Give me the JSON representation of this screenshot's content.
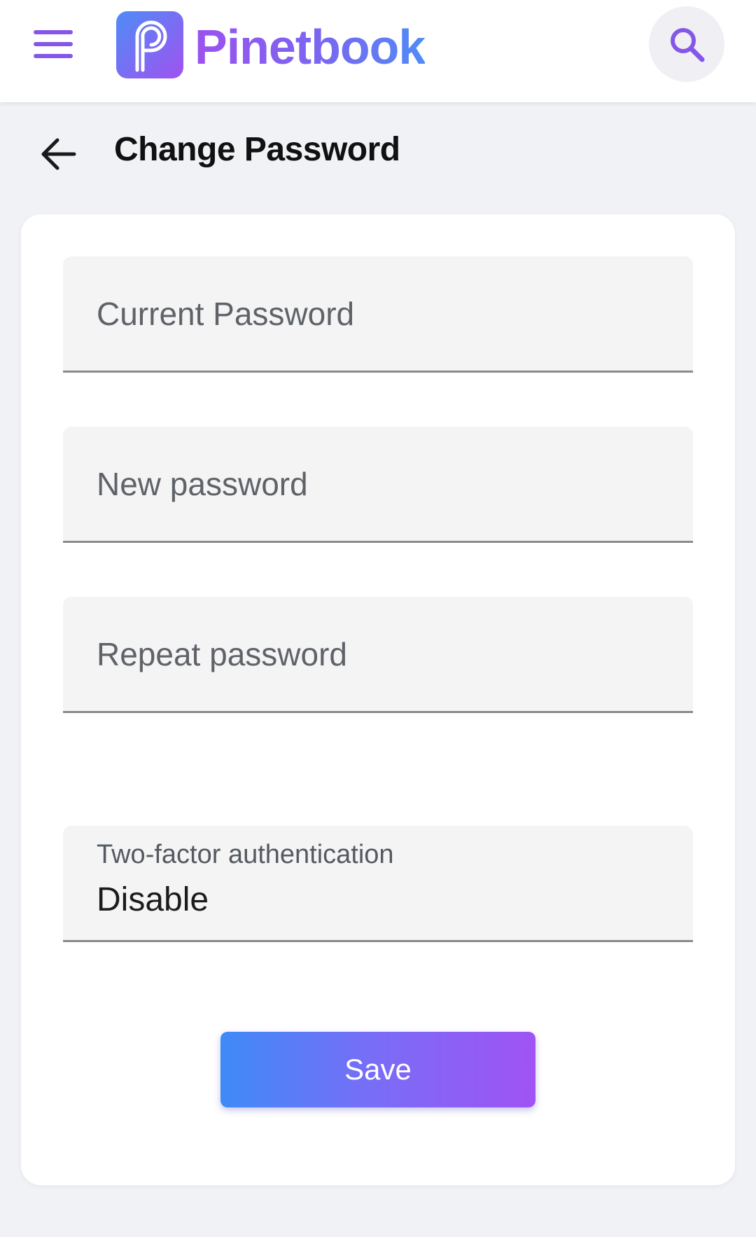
{
  "app": {
    "brand_name": "Pinetbook",
    "menu_icon": "hamburger-menu-icon",
    "search_icon": "search-icon",
    "logo_icon": "pinetbook-logo-icon",
    "accent_color": "#8557e8"
  },
  "page": {
    "title": "Change Password",
    "back_icon": "arrow-left-icon"
  },
  "form": {
    "current_password": {
      "placeholder": "Current Password",
      "value": ""
    },
    "new_password": {
      "placeholder": "New password",
      "value": ""
    },
    "repeat_password": {
      "placeholder": "Repeat password",
      "value": ""
    },
    "two_factor": {
      "label": "Two-factor authentication",
      "selected": "Disable"
    },
    "save_label": "Save"
  }
}
